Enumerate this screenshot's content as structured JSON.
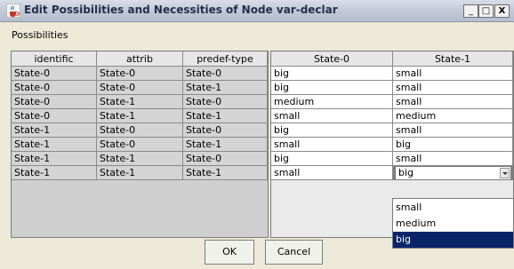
{
  "window": {
    "title": "Edit Possibilities and Necessities of Node var-declar",
    "minimize": "_",
    "maximize": "□",
    "close": "X",
    "app_icon": "java-coffee-cup-icon"
  },
  "panel_label": "Possibilities",
  "left_table": {
    "columns": [
      "identific",
      "attrib",
      "predef-type"
    ],
    "rows": [
      [
        "State-0",
        "State-0",
        "State-0"
      ],
      [
        "State-0",
        "State-0",
        "State-1"
      ],
      [
        "State-0",
        "State-1",
        "State-0"
      ],
      [
        "State-0",
        "State-1",
        "State-1"
      ],
      [
        "State-1",
        "State-0",
        "State-0"
      ],
      [
        "State-1",
        "State-0",
        "State-1"
      ],
      [
        "State-1",
        "State-1",
        "State-0"
      ],
      [
        "State-1",
        "State-1",
        "State-1"
      ]
    ]
  },
  "right_table": {
    "columns": [
      "State-0",
      "State-1"
    ],
    "rows": [
      [
        "big",
        "small"
      ],
      [
        "big",
        "small"
      ],
      [
        "medium",
        "small"
      ],
      [
        "small",
        "medium"
      ],
      [
        "big",
        "small"
      ],
      [
        "small",
        "big"
      ],
      [
        "big",
        "small"
      ],
      [
        "small",
        "big"
      ]
    ],
    "editing": {
      "row": 7,
      "col": 1,
      "value": "big"
    }
  },
  "dropdown": {
    "options": [
      "small",
      "medium",
      "big"
    ],
    "selected": "big"
  },
  "buttons": {
    "ok": "OK",
    "cancel": "Cancel"
  }
}
